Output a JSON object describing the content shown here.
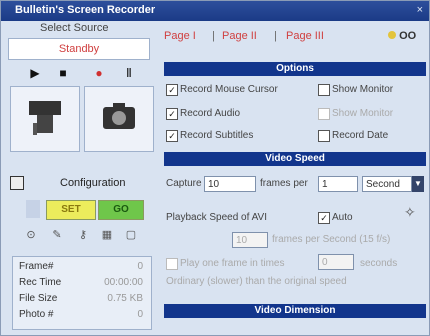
{
  "window": {
    "title": "Bulletin's Screen Recorder",
    "close_glyph": "×"
  },
  "left": {
    "select_source_label": "Select Source",
    "source_value": "Standby",
    "playback": [
      "▶",
      "■",
      "●",
      "Ⅱ"
    ],
    "configuration_label": "Configuration",
    "buttons": {
      "yellow": "SET",
      "green": "GO"
    },
    "stats": [
      {
        "k": "Frame#",
        "v": "0"
      },
      {
        "k": "Rec Time",
        "v": "00:00:00"
      },
      {
        "k": "File Size",
        "v": "0.75 KB"
      },
      {
        "k": "Photo #",
        "v": "0"
      }
    ]
  },
  "right": {
    "tabs": [
      "Page I",
      "Page II",
      "Page III"
    ],
    "tab_sep": "|",
    "corner_label": "OO",
    "options_title": "Options",
    "options": [
      {
        "label": "Record Mouse Cursor",
        "checked": true
      },
      {
        "label": "Show Monitor",
        "checked": false
      },
      {
        "label": "Record Audio",
        "checked": true
      },
      {
        "label": "Show Monitor",
        "checked": false,
        "dim": true
      },
      {
        "label": "Record Subtitles",
        "checked": true
      },
      {
        "label": "Record Date",
        "checked": false
      }
    ],
    "video_speed_title": "Video Speed",
    "capture_label": "Capture",
    "capture_value": "10",
    "frames_per_label": "frames per",
    "frames_per_value": "1",
    "unit_value": "Second",
    "playback_label": "Playback Speed of AVI",
    "auto_label": "Auto",
    "fps_value": "10",
    "fps_label": "frames per Second (15 f/s)",
    "play_label": "Play one frame in times",
    "play_value": "0",
    "play_unit": "seconds",
    "hint_text": "Ordinary (slower) than the original speed",
    "video_dimension_title": "Video Dimension"
  }
}
